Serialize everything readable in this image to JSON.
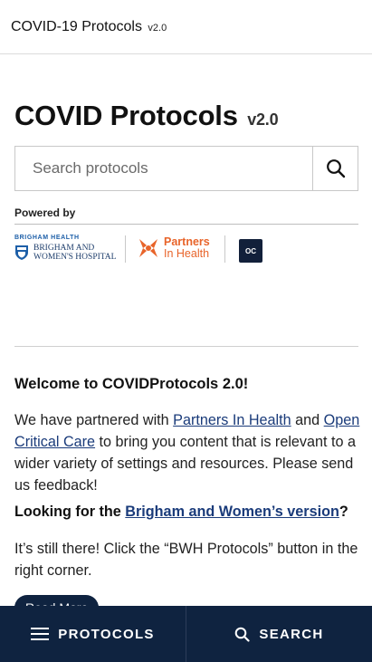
{
  "header": {
    "title": "COVID-19 Protocols",
    "version": "v2.0"
  },
  "hero": {
    "title": "COVID Protocols",
    "version": "v2.0"
  },
  "search": {
    "placeholder": "Search protocols",
    "icon": "search-icon"
  },
  "powered_by": "Powered by",
  "logos": {
    "bwh_top": "BRIGHAM HEALTH",
    "bwh_line1": "BRIGHAM AND",
    "bwh_line2": "WOMEN'S HOSPITAL",
    "pih_line1": "Partners",
    "pih_line2": "In Health",
    "occ": "OC",
    "colors": {
      "bwh_blue": "#1d5fa8",
      "pih_orange": "#e8642a",
      "occ_navy": "#12203a"
    }
  },
  "welcome": {
    "heading": "Welcome to COVIDProtocols 2.0!",
    "p1_a": "We have partnered with ",
    "p1_link1": "Partners In Health",
    "p1_b": " and ",
    "p1_link2": "Open Critical Care",
    "p1_c": " to bring you content that is relevant to a wider variety of settings and resources. Please send us feedback!",
    "looking_a": "Looking for the ",
    "looking_link": "Brigham and Women’s version",
    "looking_b": "?",
    "p2": "It’s still there! Click the “BWH Protocols” button in the right corner.",
    "read_more": "Read More"
  },
  "bottom_nav": {
    "protocols": "PROTOCOLS",
    "search": "SEARCH",
    "protocols_icon": "menu-icon",
    "search_icon": "search-icon",
    "background": "#0f2340"
  }
}
